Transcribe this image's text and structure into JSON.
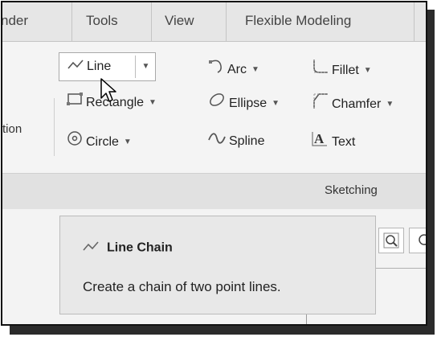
{
  "tabs": [
    {
      "label": "nder"
    },
    {
      "label": "Tools"
    },
    {
      "label": "View"
    },
    {
      "label": "Flexible Modeling"
    }
  ],
  "ribbon": {
    "left_label": "tion",
    "commands": {
      "line": "Line",
      "rectangle": "Rectangle",
      "circle": "Circle",
      "arc": "Arc",
      "ellipse": "Ellipse",
      "spline": "Spline",
      "fillet": "Fillet",
      "chamfer": "Chamfer",
      "text": "Text"
    },
    "group_label": "Sketching"
  },
  "tooltip": {
    "title": "Line Chain",
    "description": "Create a chain of two point lines."
  },
  "icons": {
    "line": "line-icon",
    "rectangle": "rectangle-icon",
    "circle": "circle-icon",
    "arc": "arc-icon",
    "ellipse": "ellipse-icon",
    "spline": "spline-icon",
    "fillet": "fillet-icon",
    "chamfer": "chamfer-icon",
    "text": "text-icon",
    "zoom": "zoom-icon",
    "cursor": "mouse-cursor-icon"
  },
  "colors": {
    "ribbon_background": "#f4f4f4",
    "tab_background": "#e6e6e6",
    "tooltip_background": "#e8e8e8",
    "frame_border": "#111111"
  }
}
